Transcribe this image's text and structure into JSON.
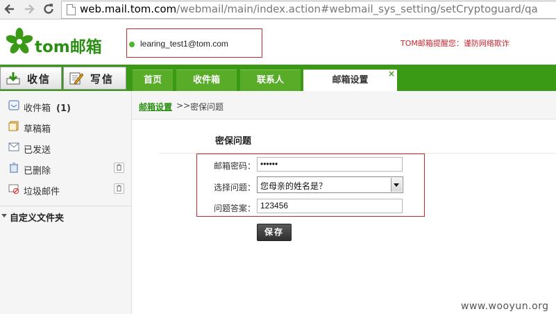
{
  "browser": {
    "url_host": "web.mail.tom.com",
    "url_path": "/webmail/main/index.action#webmail_sys_setting/setCryptoguard/qa"
  },
  "header": {
    "logo_text": "tom邮箱",
    "user_email": "learing_test1@tom.com",
    "notice": "TOM邮箱提醒您：谨防网络欺诈"
  },
  "toolbar": {
    "receive_label": "收信",
    "write_label": "写信"
  },
  "tabs": [
    {
      "label": "首页"
    },
    {
      "label": "收件箱"
    },
    {
      "label": "联系人"
    },
    {
      "label": "邮箱设置"
    }
  ],
  "tab_close_glyph": "×",
  "sidebar": {
    "folders": [
      {
        "label": "收件箱",
        "count": "(1)",
        "icon": "inbox-icon"
      },
      {
        "label": "草稿箱",
        "count": "",
        "icon": "drafts-icon"
      },
      {
        "label": "已发送",
        "count": "",
        "icon": "sent-icon"
      },
      {
        "label": "已删除",
        "count": "",
        "icon": "deleted-icon"
      },
      {
        "label": "垃圾邮件",
        "count": "",
        "icon": "spam-icon"
      }
    ],
    "custom_folders_label": "自定义文件夹"
  },
  "breadcrumb": {
    "link": "邮箱设置",
    "separator": ">>",
    "current": "密保问题"
  },
  "form": {
    "title": "密保问题",
    "password_label": "邮箱密码：",
    "password_value": "••••••",
    "question_label": "选择问题：",
    "question_value": "您母亲的姓名是？",
    "answer_label": "问题答案：",
    "answer_value": "123456",
    "save_label": "保存"
  },
  "watermark": "www.wooyun.org",
  "colors": {
    "brand_green": "#3a9a16",
    "highlight_red": "#c7262c"
  }
}
